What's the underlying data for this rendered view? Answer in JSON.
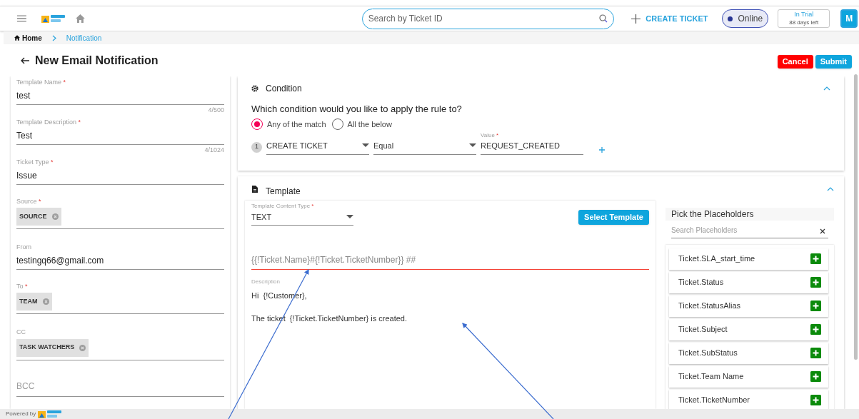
{
  "topbar": {
    "search_placeholder": "Search by Ticket ID",
    "create_label": "CREATE TICKET",
    "status": {
      "label": "Online",
      "online": true
    },
    "trial": {
      "title": "In Trial",
      "subtitle": "88 days left"
    },
    "avatar": "M"
  },
  "breadcrumb": [
    {
      "label": "Home",
      "current": false
    },
    {
      "label": "Notification",
      "current": true
    }
  ],
  "page_title": "New Email Notification",
  "actions": [
    {
      "label": "Cancel",
      "kind": "danger"
    },
    {
      "label": "Submit",
      "kind": "primary"
    }
  ],
  "fields": [
    {
      "kind": "text",
      "label": "Template Name",
      "required": true,
      "value": "test",
      "counter": "4/500"
    },
    {
      "kind": "text",
      "label": "Template Description",
      "required": true,
      "value": "Test",
      "counter": "4/1024"
    },
    {
      "kind": "text",
      "label": "Ticket Type",
      "required": true,
      "value": "Issue"
    },
    {
      "kind": "chips",
      "label": "Source",
      "required": true,
      "chips": [
        "SOURCE"
      ]
    },
    {
      "kind": "text",
      "label": "From",
      "required": false,
      "value": "testingq66@gmail.com"
    },
    {
      "kind": "chips",
      "label": "To",
      "required": true,
      "chips": [
        "TEAM"
      ]
    },
    {
      "kind": "chips",
      "label": "CC",
      "required": false,
      "chips": [
        "TASK WATCHERS"
      ]
    },
    {
      "kind": "empty",
      "placeholder": "BCC"
    }
  ],
  "condition": {
    "title": "Condition",
    "question": "Which condition would you like to apply the rule to?",
    "radios": [
      {
        "label": "Any of the match",
        "selected": true
      },
      {
        "label": "All the below",
        "selected": false
      }
    ],
    "rule": {
      "index": "1",
      "field": "CREATE TICKET",
      "operator": "Equal",
      "value_label": "Value",
      "value_required": true,
      "value": "REQUEST_CREATED"
    }
  },
  "template": {
    "title": "Template",
    "content_type": {
      "label": "Template Content Type",
      "required": true,
      "value": "TEXT"
    },
    "select_button": "Select Template",
    "subject": {
      "placeholder": "{{!Ticket.Name}#{!Ticket.TicketNumber}} ##",
      "error": true
    },
    "description_label": "Description",
    "description_lines": [
      "Hi  {!Customer},",
      "The ticket  {!Ticket.TicketNumber} is created."
    ]
  },
  "placeholders": {
    "title": "Pick the Placeholders",
    "search_placeholder": "Search Placeholders",
    "items": [
      "Ticket.SLA_start_time",
      "Ticket.Status",
      "Ticket.StatusAlias",
      "Ticket.Subject",
      "Ticket.SubStatus",
      "Ticket.Team Name",
      "Ticket.TicketNumber"
    ]
  },
  "footer": {
    "label": "Powered by"
  },
  "required_mark": "*"
}
